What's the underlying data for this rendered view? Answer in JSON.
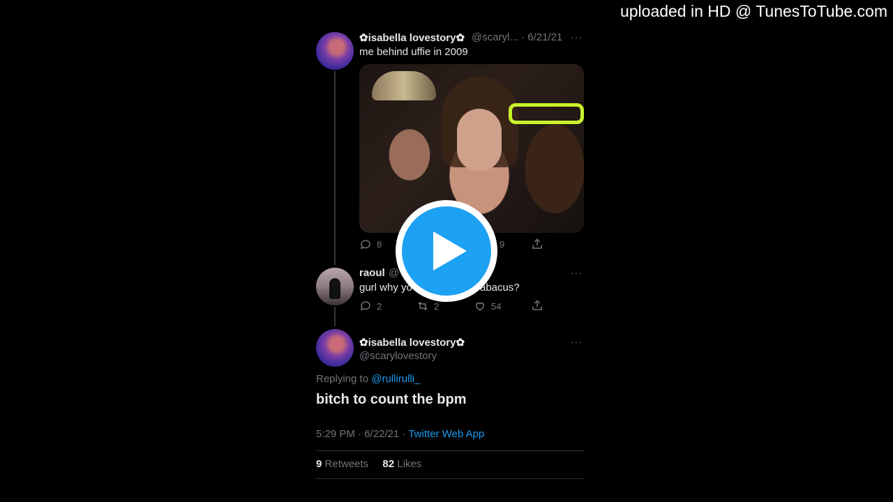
{
  "watermark": "uploaded in HD @ TunesToTube.com",
  "tweet1": {
    "name": "✿isabella lovestory✿",
    "handle": "@scaryl... · 6/21/21",
    "more": "···",
    "text": "me behind uffie in 2009",
    "replies": "8",
    "likes_partial": "9"
  },
  "tweet2": {
    "name": "raoul",
    "handle_partial": "@",
    "more": "···",
    "text_start": "gurl why yo",
    "text_end": "abacus?",
    "replies": "2",
    "retweets": "2",
    "likes": "54"
  },
  "main": {
    "name": "✿isabella lovestory✿",
    "handle": "@scarylovestory",
    "more": "···",
    "replying_prefix": "Replying to ",
    "replying_handle": "@rullirulli_",
    "text": "bitch to count the bpm",
    "time": "5:29 PM · 6/22/21 · ",
    "source": "Twitter Web App",
    "retweets_count": "9",
    "retweets_label": "Retweets",
    "likes_count": "82",
    "likes_label": "Likes"
  }
}
